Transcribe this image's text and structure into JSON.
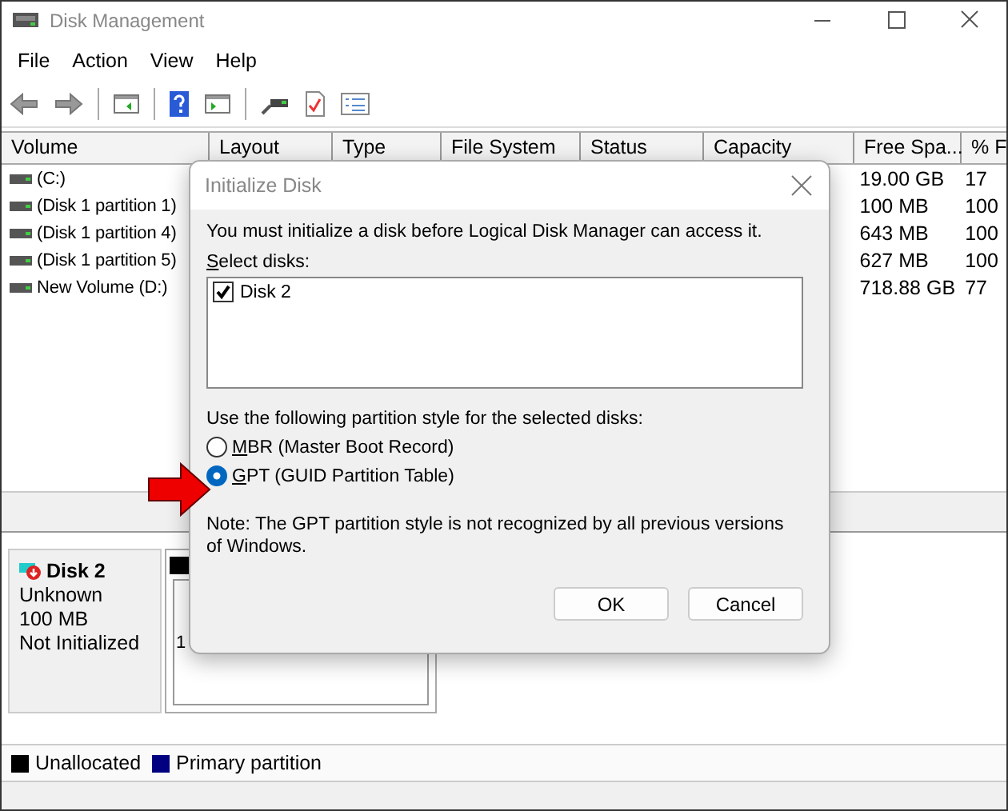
{
  "window": {
    "title": "Disk Management"
  },
  "menu": [
    "File",
    "Action",
    "View",
    "Help"
  ],
  "table": {
    "columns": [
      "Volume",
      "Layout",
      "Type",
      "File System",
      "Status",
      "Capacity",
      "Free Spa...",
      "% F"
    ],
    "rows": [
      {
        "volume": "(C:)",
        "free_space": "19.00 GB",
        "percent_free": "17"
      },
      {
        "volume": "(Disk 1 partition 1)",
        "free_space": "100 MB",
        "percent_free": "100"
      },
      {
        "volume": "(Disk 1 partition 4)",
        "free_space": "643 MB",
        "percent_free": "100"
      },
      {
        "volume": "(Disk 1 partition 5)",
        "free_space": "627 MB",
        "percent_free": "100"
      },
      {
        "volume": "New Volume (D:)",
        "free_space": "718.88 GB",
        "percent_free": "77"
      }
    ]
  },
  "disk": {
    "name": "Disk 2",
    "type": "Unknown",
    "size": "100 MB",
    "status": "Not Initialized",
    "partition_lines": [
      "1"
    ]
  },
  "legend": [
    {
      "label": "Unallocated",
      "color": "#000000"
    },
    {
      "label": "Primary partition",
      "color": "#000080"
    }
  ],
  "dialog": {
    "title": "Initialize Disk",
    "message": "You must initialize a disk before Logical Disk Manager can access it.",
    "select_label": "Select disks:",
    "disks": [
      {
        "label": "Disk 2",
        "checked": true
      }
    ],
    "style_label": "Use the following partition style for the selected disks:",
    "styles": [
      {
        "label": "MBR (Master Boot Record)",
        "selected": false
      },
      {
        "label": "GPT (GUID Partition Table)",
        "selected": true
      }
    ],
    "note": "Note: The GPT partition style is not recognized by all previous versions of Windows.",
    "buttons": [
      "OK",
      "Cancel"
    ]
  }
}
